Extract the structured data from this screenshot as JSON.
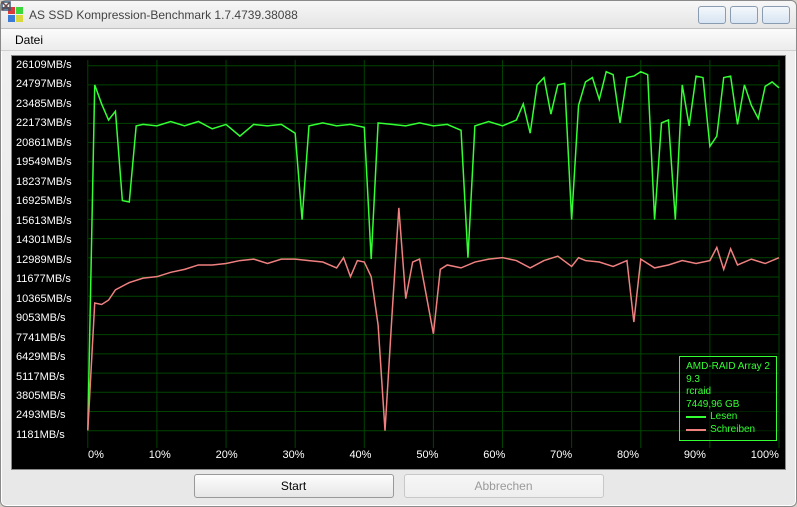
{
  "window": {
    "title": "AS SSD Kompression-Benchmark 1.7.4739.38088",
    "icon_colors": [
      "#d83b3b",
      "#3bd83b",
      "#3b7bd8",
      "#d8d83b"
    ]
  },
  "menu": {
    "file": "Datei"
  },
  "buttons": {
    "start": "Start",
    "cancel": "Abbrechen"
  },
  "legend": {
    "drive_line1": "AMD-RAID Array 2",
    "drive_line2": "9.3",
    "driver": "rcraid",
    "size": "7449,96 GB",
    "read": "Lesen",
    "write": "Schreiben",
    "read_color": "#33ff33",
    "write_color": "#f08080"
  },
  "chart_data": {
    "type": "line",
    "xlabel": "%",
    "ylabel": "MB/s",
    "x_ticks": [
      "0%",
      "10%",
      "20%",
      "30%",
      "40%",
      "50%",
      "60%",
      "70%",
      "80%",
      "90%",
      "100%"
    ],
    "y_ticks": [
      1181,
      2493,
      3805,
      5117,
      6429,
      7741,
      9053,
      10365,
      11677,
      12989,
      14301,
      15613,
      16925,
      18237,
      19549,
      20861,
      22173,
      23485,
      24797,
      26109
    ],
    "y_tick_unit": "MB/s",
    "y_range": [
      0,
      26500
    ],
    "x_range": [
      0,
      100
    ],
    "series": [
      {
        "name": "Lesen",
        "color": "#33ff33",
        "values": [
          [
            0,
            1200
          ],
          [
            1,
            24800
          ],
          [
            2,
            23500
          ],
          [
            3,
            22400
          ],
          [
            4,
            23000
          ],
          [
            5,
            16900
          ],
          [
            6,
            16800
          ],
          [
            7,
            22000
          ],
          [
            8,
            22100
          ],
          [
            10,
            22000
          ],
          [
            12,
            22300
          ],
          [
            14,
            22000
          ],
          [
            16,
            22300
          ],
          [
            18,
            21800
          ],
          [
            20,
            22100
          ],
          [
            22,
            21300
          ],
          [
            24,
            22100
          ],
          [
            26,
            22000
          ],
          [
            28,
            22100
          ],
          [
            30,
            21500
          ],
          [
            31,
            15600
          ],
          [
            32,
            22000
          ],
          [
            34,
            22200
          ],
          [
            36,
            22000
          ],
          [
            38,
            22100
          ],
          [
            40,
            21900
          ],
          [
            41,
            12900
          ],
          [
            42,
            22200
          ],
          [
            44,
            22100
          ],
          [
            46,
            22000
          ],
          [
            48,
            22200
          ],
          [
            50,
            22000
          ],
          [
            52,
            22100
          ],
          [
            54,
            21700
          ],
          [
            55,
            13000
          ],
          [
            56,
            22000
          ],
          [
            58,
            22300
          ],
          [
            60,
            22000
          ],
          [
            62,
            22400
          ],
          [
            63,
            23500
          ],
          [
            64,
            21500
          ],
          [
            65,
            24800
          ],
          [
            66,
            25300
          ],
          [
            67,
            22800
          ],
          [
            68,
            24800
          ],
          [
            69,
            24900
          ],
          [
            70,
            15600
          ],
          [
            71,
            23400
          ],
          [
            72,
            25000
          ],
          [
            73,
            25300
          ],
          [
            74,
            23800
          ],
          [
            75,
            25700
          ],
          [
            76,
            25500
          ],
          [
            77,
            22200
          ],
          [
            78,
            25300
          ],
          [
            79,
            25400
          ],
          [
            80,
            25700
          ],
          [
            81,
            25500
          ],
          [
            82,
            15600
          ],
          [
            83,
            22200
          ],
          [
            84,
            22400
          ],
          [
            85,
            15600
          ],
          [
            86,
            24800
          ],
          [
            87,
            22000
          ],
          [
            88,
            25400
          ],
          [
            89,
            25300
          ],
          [
            90,
            20600
          ],
          [
            91,
            21300
          ],
          [
            92,
            25300
          ],
          [
            93,
            25400
          ],
          [
            94,
            22100
          ],
          [
            95,
            24800
          ],
          [
            96,
            23400
          ],
          [
            97,
            22500
          ],
          [
            98,
            24700
          ],
          [
            99,
            25000
          ],
          [
            100,
            24600
          ]
        ]
      },
      {
        "name": "Schreiben",
        "color": "#f08080",
        "values": [
          [
            0,
            1200
          ],
          [
            1,
            9900
          ],
          [
            2,
            9800
          ],
          [
            3,
            10100
          ],
          [
            4,
            10800
          ],
          [
            6,
            11300
          ],
          [
            8,
            11600
          ],
          [
            10,
            11700
          ],
          [
            12,
            12000
          ],
          [
            14,
            12200
          ],
          [
            16,
            12500
          ],
          [
            18,
            12500
          ],
          [
            20,
            12600
          ],
          [
            22,
            12800
          ],
          [
            24,
            12900
          ],
          [
            26,
            12600
          ],
          [
            28,
            12900
          ],
          [
            30,
            12900
          ],
          [
            32,
            12800
          ],
          [
            34,
            12700
          ],
          [
            36,
            12300
          ],
          [
            37,
            13000
          ],
          [
            38,
            11700
          ],
          [
            39,
            12800
          ],
          [
            40,
            12700
          ],
          [
            41,
            11700
          ],
          [
            42,
            8400
          ],
          [
            43,
            1180
          ],
          [
            44,
            9000
          ],
          [
            45,
            16400
          ],
          [
            46,
            10200
          ],
          [
            47,
            12700
          ],
          [
            48,
            12900
          ],
          [
            50,
            7800
          ],
          [
            51,
            12200
          ],
          [
            52,
            12500
          ],
          [
            54,
            12300
          ],
          [
            56,
            12700
          ],
          [
            58,
            12900
          ],
          [
            60,
            13000
          ],
          [
            62,
            12800
          ],
          [
            64,
            12300
          ],
          [
            66,
            12800
          ],
          [
            68,
            13100
          ],
          [
            70,
            12400
          ],
          [
            71,
            13000
          ],
          [
            72,
            12800
          ],
          [
            74,
            12700
          ],
          [
            76,
            12400
          ],
          [
            78,
            12800
          ],
          [
            79,
            8600
          ],
          [
            80,
            12900
          ],
          [
            82,
            12300
          ],
          [
            84,
            12500
          ],
          [
            86,
            12800
          ],
          [
            88,
            12600
          ],
          [
            90,
            12800
          ],
          [
            91,
            13700
          ],
          [
            92,
            12200
          ],
          [
            93,
            13600
          ],
          [
            94,
            12500
          ],
          [
            96,
            12900
          ],
          [
            98,
            12600
          ],
          [
            100,
            13000
          ]
        ]
      }
    ]
  }
}
